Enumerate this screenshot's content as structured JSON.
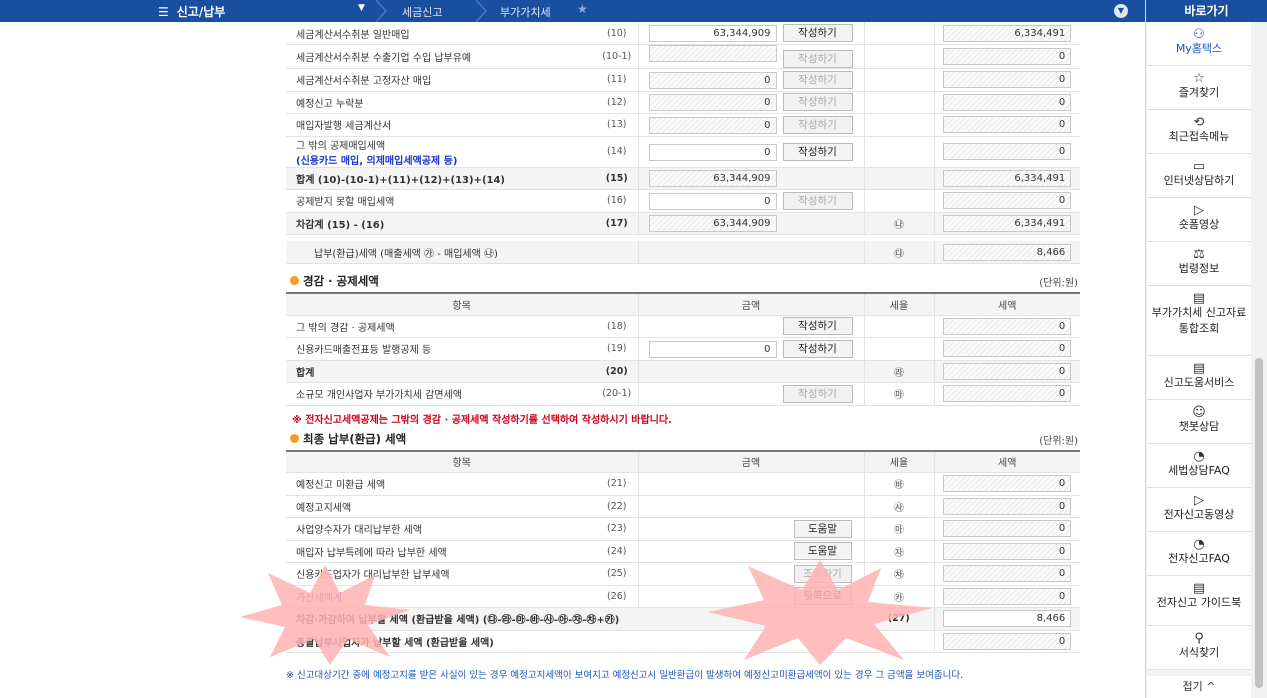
{
  "topbar": {
    "menu_label": "신고/납부",
    "breadcrumb": [
      "세금신고",
      "부가가치세"
    ]
  },
  "rightpanel": {
    "title": "바로가기",
    "items": [
      {
        "label": "My홈택스",
        "icon": "person-icon"
      },
      {
        "label": "즐겨찾기",
        "icon": "star-icon"
      },
      {
        "label": "최근접속메뉴",
        "icon": "recent-icon"
      },
      {
        "label": "인터넷상담하기",
        "icon": "monitor-icon"
      },
      {
        "label": "숏폼영상",
        "icon": "play-icon"
      },
      {
        "label": "법령정보",
        "icon": "gavel-icon"
      },
      {
        "label": "부가가치세 신고자료 통합조회",
        "icon": "book-icon"
      },
      {
        "label": "신고도움서비스",
        "icon": "book-icon"
      },
      {
        "label": "챗봇상담",
        "icon": "chatbot-icon"
      },
      {
        "label": "세법상담FAQ",
        "icon": "chat-icon"
      },
      {
        "label": "전자신고동영상",
        "icon": "play-icon"
      },
      {
        "label": "전자신고FAQ",
        "icon": "chat-icon"
      },
      {
        "label": "전자신고 가이드북",
        "icon": "book-icon"
      },
      {
        "label": "서식찾기",
        "icon": "search-icon"
      }
    ],
    "fold_label": "접기 ^"
  },
  "purchase_rows": [
    {
      "label": "세금계산서수취분 일반매입",
      "num": "(10)",
      "amount": "63,344,909",
      "btn": "작성하기",
      "btn_enabled": true,
      "tax": "6,334,491"
    },
    {
      "label": "세금계산서수취분 수출기업 수입 납부유예",
      "num": "(10-1)",
      "amount": "",
      "btn": "작성하기",
      "btn_enabled": false,
      "tax": "0"
    },
    {
      "label": "세금계산서수취분 고정자산 매입",
      "num": "(11)",
      "amount": "0",
      "btn": "작성하기",
      "btn_enabled": false,
      "tax": "0"
    },
    {
      "label": "예정신고 누락분",
      "num": "(12)",
      "amount": "0",
      "btn": "작성하기",
      "btn_enabled": false,
      "tax": "0"
    },
    {
      "label": "매입자발행 세금계산서",
      "num": "(13)",
      "amount": "0",
      "btn": "작성하기",
      "btn_enabled": false,
      "tax": "0"
    }
  ],
  "other_deduction": {
    "label1": "그 밖의 공제매입세액",
    "label2": "(신용카드 매입, 의제매입세액공제 등)",
    "num": "(14)",
    "amount": "0",
    "btn": "작성하기",
    "tax": "0"
  },
  "sum_row": {
    "label": "합계 (10)-(10-1)+(11)+(12)+(13)+(14)",
    "num": "(15)",
    "amount": "63,344,909",
    "tax": "6,334,491"
  },
  "nondeduct_row": {
    "label": "공제받지 못할 매입세액",
    "num": "(16)",
    "amount": "0",
    "btn": "작성하기",
    "tax": "0"
  },
  "diff_row": {
    "label": "차감계 (15) - (16)",
    "num": "(17)",
    "amount": "63,344,909",
    "sym": "㉯",
    "tax": "6,334,491"
  },
  "payable_row": {
    "label": "납부(환급)세액 (매출세액 ㉮ - 매입세액 ㉯)",
    "sym": "㉰",
    "tax": "8,466"
  },
  "reduction": {
    "title": "경감 · 공제세액",
    "unit": "(단위:원)",
    "headers": [
      "항목",
      "금액",
      "세율",
      "세액"
    ],
    "rows": [
      {
        "label": "그 밖의 경감 · 공제세액",
        "num": "(18)",
        "amount": null,
        "btn": "작성하기",
        "btn_enabled": true,
        "sym": "",
        "tax": "0"
      },
      {
        "label": "신용카드매출전표등 발행공제 등",
        "num": "(19)",
        "amount": "0",
        "btn": "작성하기",
        "btn_enabled": true,
        "sym": "",
        "tax": "0"
      },
      {
        "label": "합계",
        "num": "(20)",
        "amount": null,
        "btn": null,
        "sym": "㉱",
        "tax": "0",
        "bold": true
      },
      {
        "label": "소규모 개인사업자 부가가치세 감면세액",
        "num": "(20-1)",
        "amount": null,
        "btn": "작성하기",
        "btn_enabled": false,
        "sym": "㉲",
        "tax": "0"
      }
    ],
    "note": "※ 전자신고세액공제는 그밖의 경감 · 공제세액 작성하기를 선택하여 작성하시기 바랍니다."
  },
  "final": {
    "title": "최종 납부(환급) 세액",
    "unit": "(단위:원)",
    "headers": [
      "항목",
      "금액",
      "세율",
      "세액"
    ],
    "rows": [
      {
        "label": "예정신고 미환급 세액",
        "num": "(21)",
        "btn": null,
        "sym": "㉳",
        "tax": "0"
      },
      {
        "label": "예정고지세액",
        "num": "(22)",
        "btn": null,
        "sym": "㉴",
        "tax": "0"
      },
      {
        "label": "사업양수자가 대리납부한 세액",
        "num": "(23)",
        "btn": "도움말",
        "btn_enabled": true,
        "sym": "㉵",
        "tax": "0"
      },
      {
        "label": "매입자 납부특례에 따라 납부한 세액",
        "num": "(24)",
        "btn": "도움말",
        "btn_enabled": true,
        "sym": "㉶",
        "tax": "0"
      },
      {
        "label": "신용카드업자가 대리납부한 납부세액",
        "num": "(25)",
        "btn": "조회하기",
        "btn_enabled": false,
        "sym": "㉷",
        "tax": "0"
      },
      {
        "label": "가산세액계",
        "num": "(26)",
        "btn": "뒷쪽으로",
        "btn_enabled": true,
        "sym": "㉸",
        "tax": "0",
        "purple": true
      }
    ],
    "subtract_row": {
      "label": "차감·가감하여 납부할 세액 (환급받을 세액) (㉰-㉱-㉲-㉳-㉴-㉵-㉶-㉷+㉸)",
      "num": "(27)",
      "tax": "8,466"
    },
    "consolidated_row": {
      "label": "총괄납부사업자가 납부할 세액 (환급받을 세액)",
      "tax": "0"
    }
  },
  "footnote": "※ 신고대상기간 중에 예정고지를 받은 사실이 있는 경우 예정고지세액이 보여지고 예정신고시 일반환급이 발생하여 예정신고미환급세액이 있는 경우 그 금액을 보여줍니다.",
  "colors": {
    "nav": "#1a4fa0",
    "accent": "#f0a020",
    "warning": "#d0021b",
    "burst": "#ffb3b3"
  }
}
